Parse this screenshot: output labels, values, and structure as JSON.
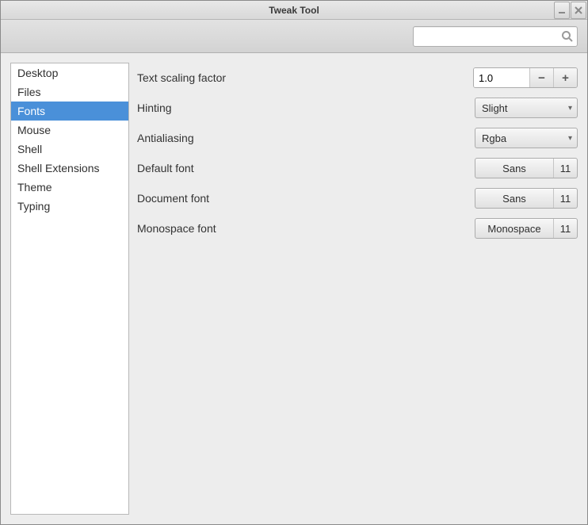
{
  "window": {
    "title": "Tweak Tool"
  },
  "search": {
    "value": ""
  },
  "sidebar": {
    "items": [
      {
        "label": "Desktop",
        "selected": false
      },
      {
        "label": "Files",
        "selected": false
      },
      {
        "label": "Fonts",
        "selected": true
      },
      {
        "label": "Mouse",
        "selected": false
      },
      {
        "label": "Shell",
        "selected": false
      },
      {
        "label": "Shell Extensions",
        "selected": false
      },
      {
        "label": "Theme",
        "selected": false
      },
      {
        "label": "Typing",
        "selected": false
      }
    ]
  },
  "settings": {
    "text_scaling": {
      "label": "Text scaling factor",
      "value": "1.0"
    },
    "hinting": {
      "label": "Hinting",
      "value": "Slight"
    },
    "antialiasing": {
      "label": "Antialiasing",
      "value": "Rgba"
    },
    "default_font": {
      "label": "Default font",
      "name": "Sans",
      "size": "11"
    },
    "document_font": {
      "label": "Document font",
      "name": "Sans",
      "size": "11"
    },
    "monospace_font": {
      "label": "Monospace font",
      "name": "Monospace",
      "size": "11"
    }
  }
}
